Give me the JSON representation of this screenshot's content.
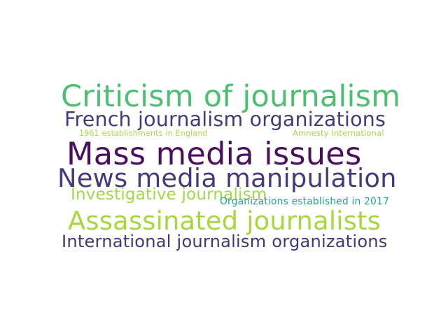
{
  "words": [
    {
      "text": "Criticism of journalism",
      "color": "#4dbf72"
    },
    {
      "text": "French journalism organizations",
      "color": "#433a7a"
    },
    {
      "text": "1961 establishments in England",
      "color": "#a7d94f"
    },
    {
      "text": "Amnesty International",
      "color": "#a2d94b"
    },
    {
      "text": "Mass media issues",
      "color": "#4b0f5e"
    },
    {
      "text": "News media manipulation",
      "color": "#463a7e"
    },
    {
      "text": "Investigative journalism",
      "color": "#9fd84a"
    },
    {
      "text": "Organizations established in 2017",
      "color": "#23a48a"
    },
    {
      "text": "Assassinated journalists",
      "color": "#a6d83e"
    },
    {
      "text": "International journalism organizations",
      "color": "#3e3a78"
    }
  ]
}
